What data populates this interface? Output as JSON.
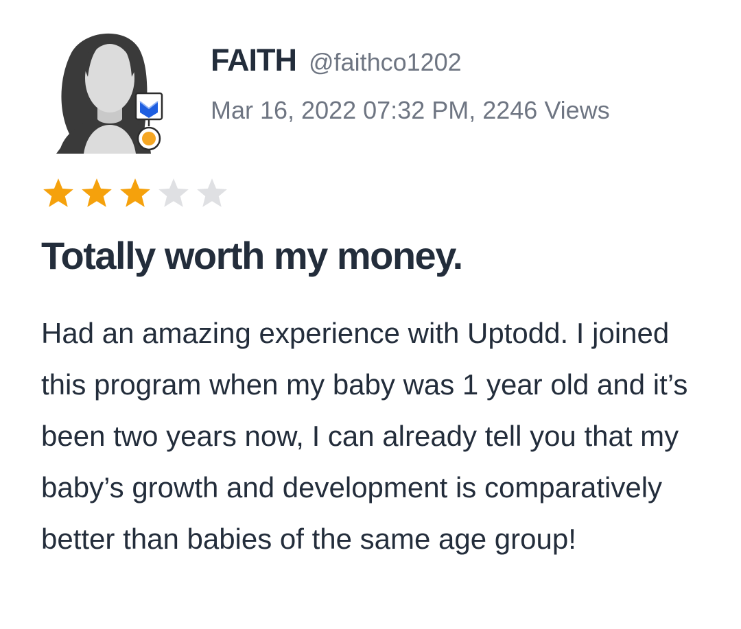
{
  "review": {
    "author_name": "FAITH",
    "author_handle": "@faithco1202",
    "meta": "Mar 16, 2022 07:32 PM, 2246 Views",
    "rating": 3,
    "rating_max": 5,
    "title": "Totally worth my money.",
    "body": "Had an amazing experience with Uptodd. I joined this program when my baby was 1 year old and it’s been two years now, I can already tell you that my baby’s growth and development is comparatively better than babies of the same age group!"
  },
  "icons": {
    "avatar": "default-user-avatar-icon",
    "badge": "verified-badge-icon",
    "star_filled": "star-filled-icon",
    "star_empty": "star-empty-icon"
  },
  "colors": {
    "text": "#232d3b",
    "muted": "#6e7582",
    "star_filled": "#f5a10c",
    "star_empty": "#dfe0e3",
    "badge_blue": "#1f5fe0",
    "badge_orange": "#f5a623"
  }
}
